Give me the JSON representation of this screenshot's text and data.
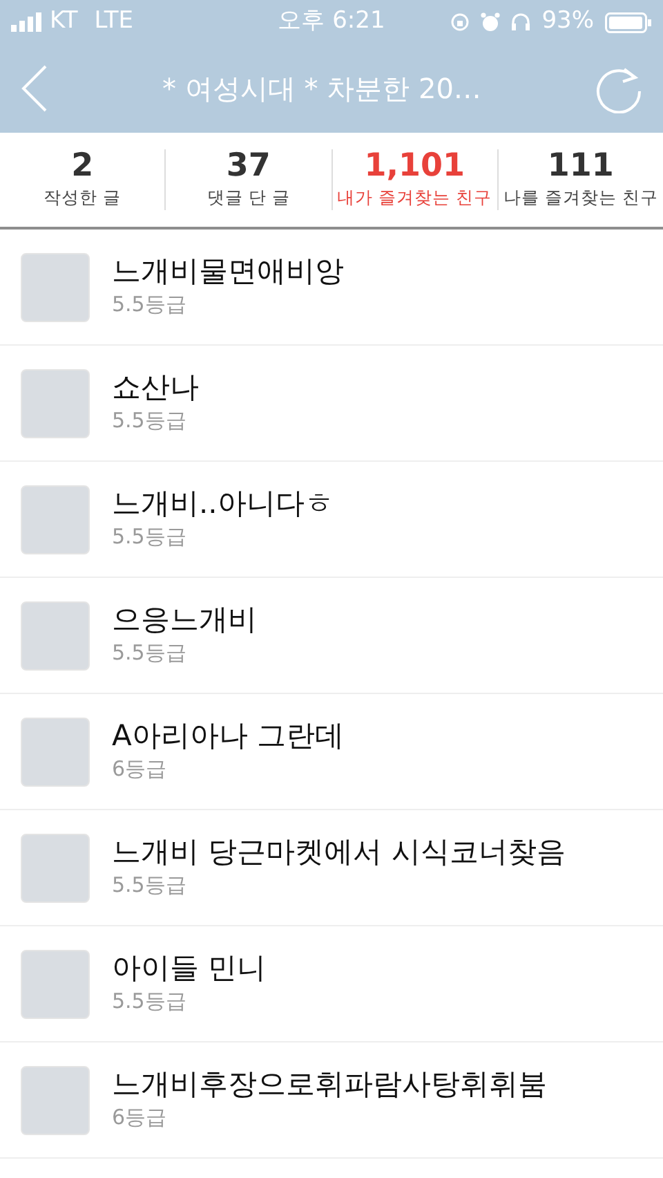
{
  "status_bar": {
    "carrier": "KT",
    "network": "LTE",
    "time": "오후 6:21",
    "battery": "93%"
  },
  "nav": {
    "title": "* 여성시대 *  차분한 20…"
  },
  "stats": [
    {
      "count": "2",
      "label": "작성한 글",
      "selected": false
    },
    {
      "count": "37",
      "label": "댓글 단 글",
      "selected": false
    },
    {
      "count": "1,101",
      "label": "내가 즐겨찾는 친구",
      "selected": true
    },
    {
      "count": "111",
      "label": "나를 즐겨찾는 친구",
      "selected": false
    }
  ],
  "friends": [
    {
      "name": "느개비물면애비앙",
      "grade": "5.5등급"
    },
    {
      "name": "쇼산나",
      "grade": "5.5등급"
    },
    {
      "name": "느개비..아니다ㅎ",
      "grade": "5.5등급"
    },
    {
      "name": "으응느개비",
      "grade": "5.5등급"
    },
    {
      "name": "A아리아나 그란데",
      "grade": "6등급"
    },
    {
      "name": "느개비 당근마켓에서 시식코너찾음",
      "grade": "5.5등급"
    },
    {
      "name": "아이들 민니",
      "grade": "5.5등급"
    },
    {
      "name": "느개비후장으로휘파람사탕휘휘붐",
      "grade": "6등급"
    }
  ]
}
